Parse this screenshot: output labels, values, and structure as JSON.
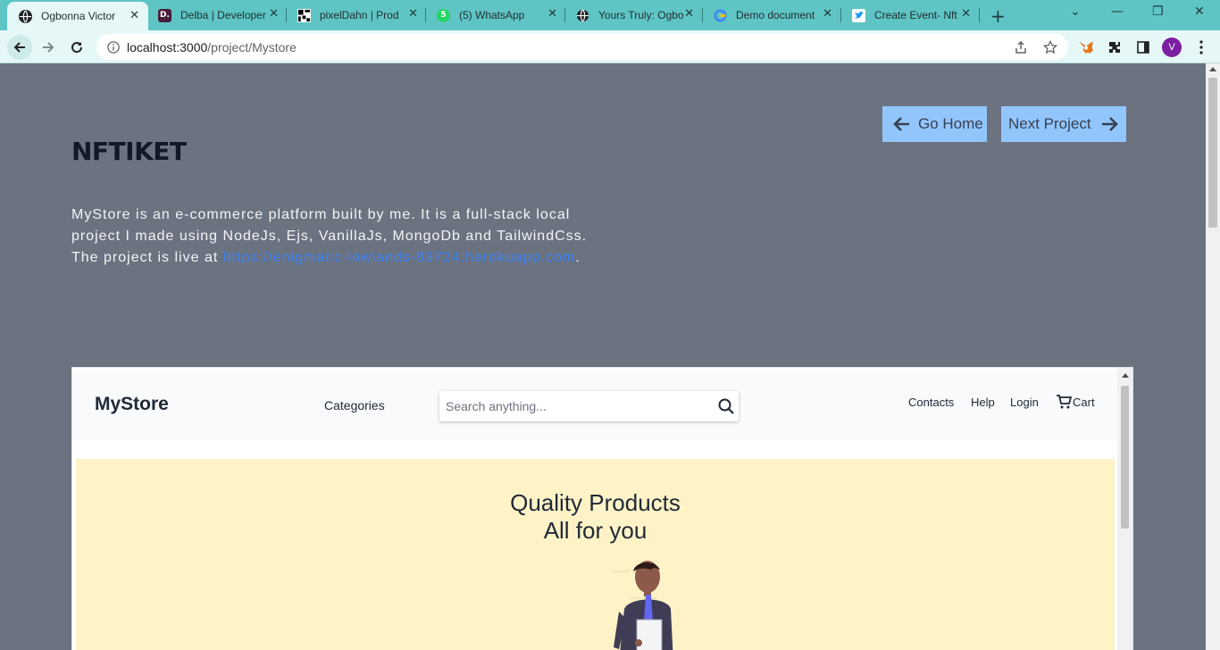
{
  "browser": {
    "tabs": [
      {
        "title": "Ogbonna Victor",
        "icon": "globe-icon",
        "active": true
      },
      {
        "title": "Delba | Developer",
        "icon": "delba-icon",
        "active": false
      },
      {
        "title": "pixelDahn | Prod",
        "icon": "qr-icon",
        "active": false
      },
      {
        "title": "(5) WhatsApp",
        "icon": "whatsapp-icon",
        "active": false
      },
      {
        "title": "Yours Truly: Ogbo",
        "icon": "globe-icon",
        "active": false
      },
      {
        "title": "Demo document",
        "icon": "google-icon",
        "active": false
      },
      {
        "title": "Create Event- Nft",
        "icon": "bird-icon",
        "active": false
      }
    ],
    "new_tab_label": "+",
    "address": {
      "host": "localhost:3000",
      "path": "/project/Mystore"
    },
    "profile_initial": "V",
    "colors": {
      "tabstrip": "#5fc4c4",
      "toolbar": "#e6f7f7",
      "profile": "#7b1fa2"
    }
  },
  "page": {
    "title": "NFTIKET",
    "description_prefix": "MyStore is an e-commerce platform built by me. It is a full-stack local project I made using NodeJs, Ejs, VanillaJs, MongoDb and TailwindCss. The project is live at ",
    "description_link": "https://enigmatic-lowlands-83724.herokuapp.com",
    "description_suffix": ".",
    "go_home_label": "Go Home",
    "next_project_label": "Next Project",
    "colors": {
      "background": "#6b7280",
      "button": "#93c5fd",
      "link": "#3b82f6"
    }
  },
  "preview": {
    "logo": "MyStore",
    "categories_label": "Categories",
    "search_placeholder": "Search anything...",
    "links": [
      "Contacts",
      "Help",
      "Login"
    ],
    "cart_label": "Cart",
    "hero_line1": "Quality Products",
    "hero_line2": "All for you",
    "colors": {
      "hero": "#fef3c7",
      "header": "#f8fafc"
    }
  }
}
